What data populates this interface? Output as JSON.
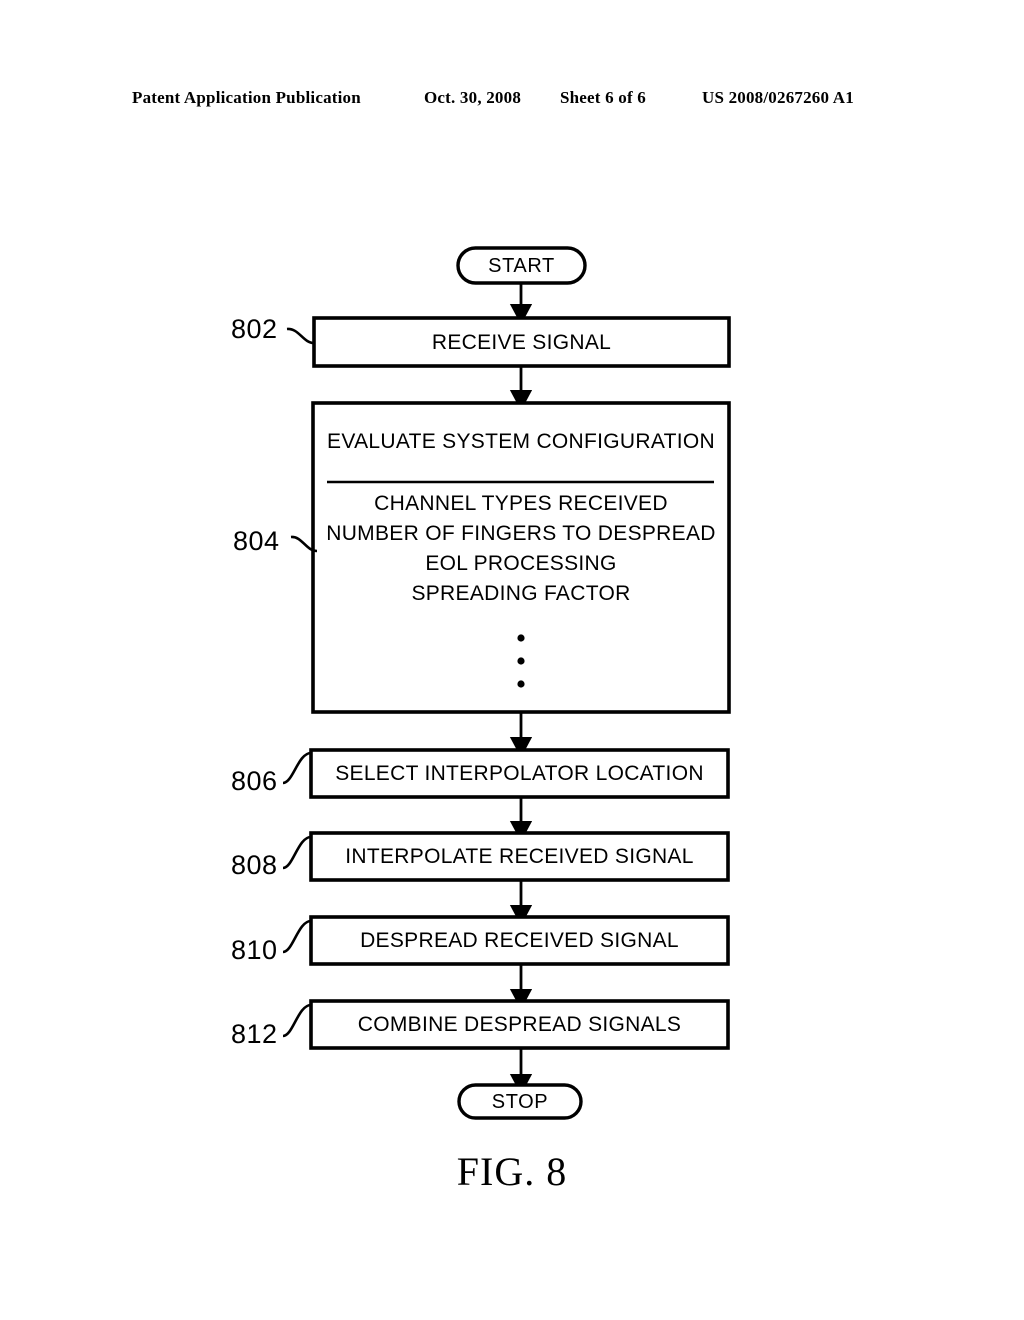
{
  "header": {
    "publication": "Patent Application Publication",
    "date": "Oct. 30, 2008",
    "sheet": "Sheet 6 of 6",
    "patent_number": "US 2008/0267260 A1"
  },
  "figure": {
    "caption": "FIG. 8",
    "start_label": "START",
    "stop_label": "STOP",
    "ellipsis": "·",
    "steps": [
      {
        "ref": "802",
        "label": "RECEIVE SIGNAL"
      },
      {
        "ref": "804",
        "label": "EVALUATE SYSTEM CONFIGURATION",
        "items": [
          "CHANNEL TYPES RECEIVED",
          "NUMBER OF FINGERS TO DESPREAD",
          "EOL PROCESSING",
          "SPREADING FACTOR"
        ]
      },
      {
        "ref": "806",
        "label": "SELECT INTERPOLATOR LOCATION"
      },
      {
        "ref": "808",
        "label": "INTERPOLATE RECEIVED SIGNAL"
      },
      {
        "ref": "810",
        "label": "DESPREAD RECEIVED SIGNAL"
      },
      {
        "ref": "812",
        "label": "COMBINE DESPREAD SIGNALS"
      }
    ]
  },
  "colors": {
    "ink": "#000000",
    "paper": "#ffffff"
  }
}
